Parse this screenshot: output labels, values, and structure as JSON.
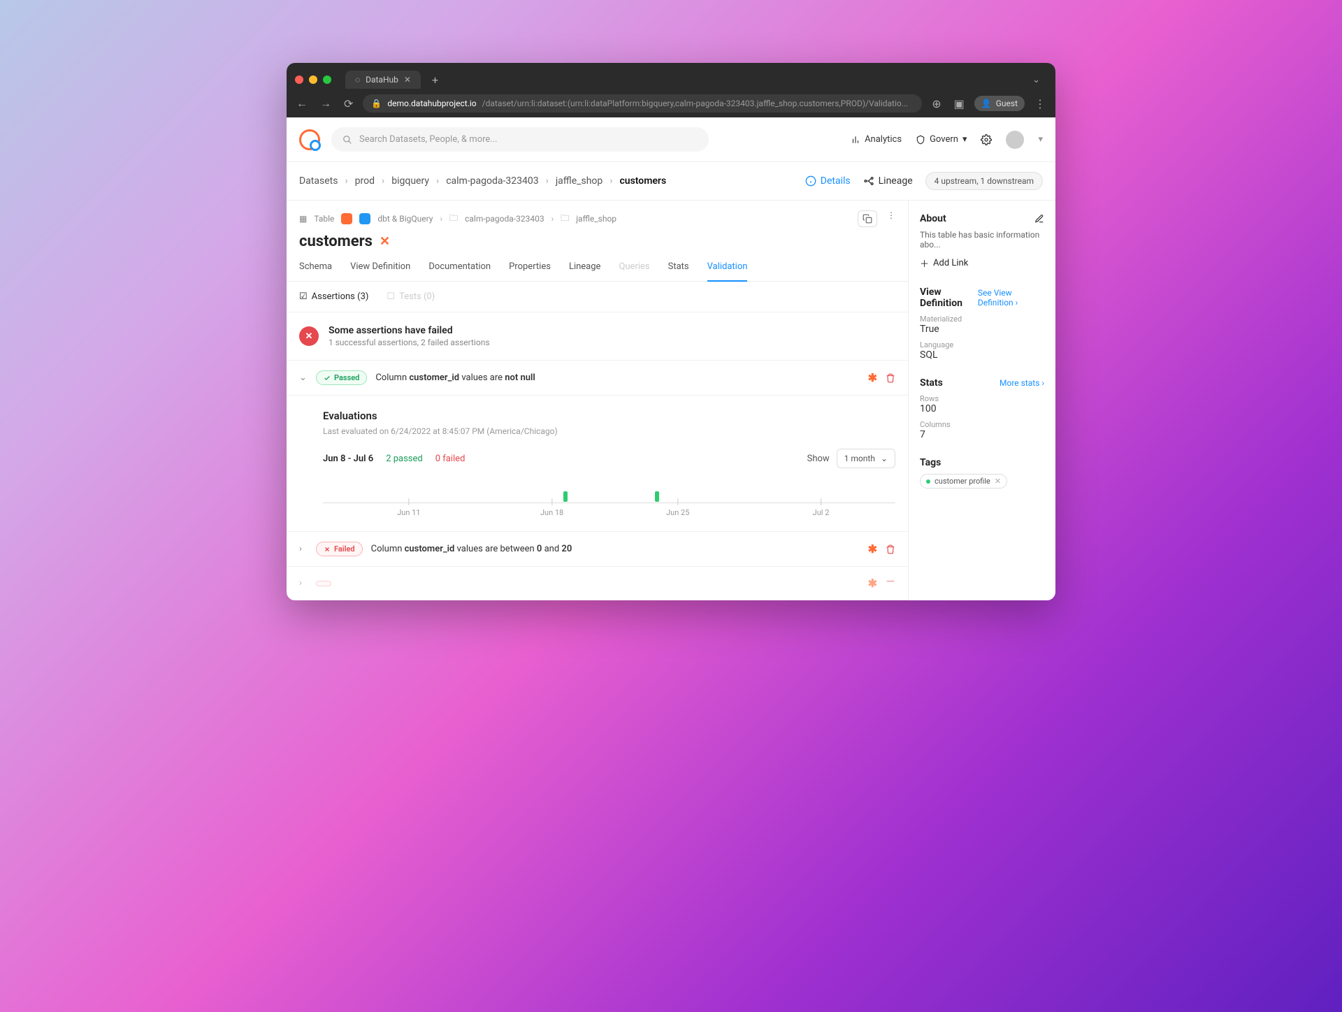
{
  "browser": {
    "tab_title": "DataHub",
    "url_domain": "demo.datahubproject.io",
    "url_path": "/dataset/urn:li:dataset:(urn:li:dataPlatform:bigquery,calm-pagoda-323403.jaffle_shop.customers,PROD)/Validatio...",
    "guest_label": "Guest"
  },
  "header": {
    "search_placeholder": "Search Datasets, People, & more...",
    "analytics_label": "Analytics",
    "govern_label": "Govern"
  },
  "breadcrumb": {
    "root": "Datasets",
    "items": [
      "prod",
      "bigquery",
      "calm-pagoda-323403",
      "jaffle_shop"
    ],
    "current": "customers",
    "details_label": "Details",
    "lineage_label": "Lineage",
    "lineage_summary": "4 upstream, 1 downstream"
  },
  "entity": {
    "type_label": "Table",
    "platform_label": "dbt & BigQuery",
    "crumb1": "calm-pagoda-323403",
    "crumb2": "jaffle_shop",
    "title": "customers"
  },
  "tabs": {
    "schema": "Schema",
    "view_definition": "View Definition",
    "documentation": "Documentation",
    "properties": "Properties",
    "lineage": "Lineage",
    "queries": "Queries",
    "stats": "Stats",
    "validation": "Validation"
  },
  "subtabs": {
    "assertions_label": "Assertions (3)",
    "tests_label": "Tests (0)"
  },
  "alert": {
    "title": "Some assertions have failed",
    "subtitle": "1 successful assertions, 2 failed assertions"
  },
  "assertions": [
    {
      "status": "Passed",
      "text_pre": "Column ",
      "col": "customer_id",
      "text_mid": " values are ",
      "rule": "not null",
      "text_post": ""
    },
    {
      "status": "Failed",
      "text_pre": "Column ",
      "col": "customer_id",
      "text_mid": " values are between ",
      "rule": "0",
      "text_post": " and ",
      "rule2": "20"
    }
  ],
  "evaluations": {
    "title": "Evaluations",
    "last_label": "Last evaluated on 6/24/2022 at 8:45:07 PM (America/Chicago)",
    "range": "Jun 8 - Jul 6",
    "passed": "2 passed",
    "failed": "0 failed",
    "show_label": "Show",
    "show_value": "1 month",
    "ticks": [
      "Jun 11",
      "Jun 18",
      "Jun 25",
      "Jul 2"
    ]
  },
  "sidebar": {
    "about_title": "About",
    "about_desc": "This table has basic information abo...",
    "add_link_label": "Add Link",
    "viewdef_title": "View Definition",
    "viewdef_link": "See View Definition ›",
    "materialized_label": "Materialized",
    "materialized_value": "True",
    "language_label": "Language",
    "language_value": "SQL",
    "stats_title": "Stats",
    "stats_link": "More stats ›",
    "rows_label": "Rows",
    "rows_value": "100",
    "columns_label": "Columns",
    "columns_value": "7",
    "tags_title": "Tags",
    "tag1": "customer profile"
  },
  "chart_data": {
    "type": "bar",
    "categories": [
      "Jun 11",
      "Jun 18",
      "Jun 25",
      "Jul 2"
    ],
    "series": [
      {
        "name": "passed",
        "color": "#2ecc71",
        "points": [
          {
            "x": "Jun 19",
            "value": 1
          },
          {
            "x": "Jun 24",
            "value": 1
          }
        ]
      }
    ],
    "xrange": [
      "Jun 8",
      "Jul 6"
    ],
    "ylabel": "",
    "title": "Evaluations"
  }
}
